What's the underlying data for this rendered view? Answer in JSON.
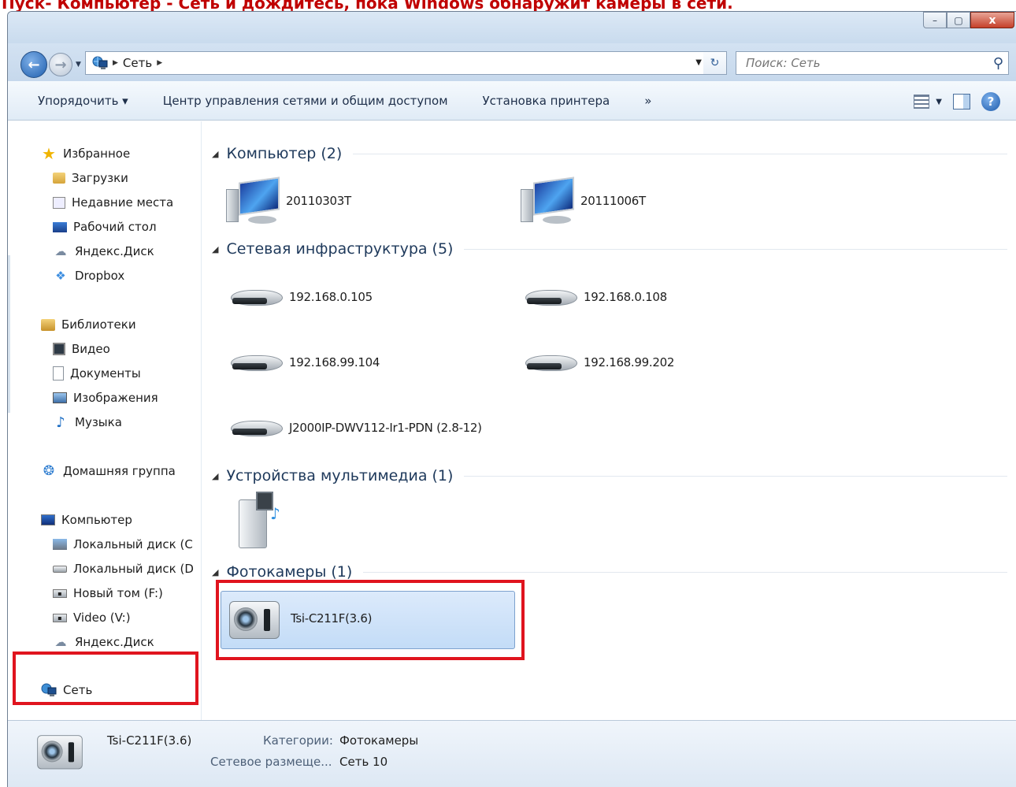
{
  "annotation": "Пуск- Компьютер - Сеть и дождитесь, пока Windows обнаружит камеры в сети.",
  "window": {
    "caption_buttons": {
      "minimize": "–",
      "maximize": "▢",
      "close": "x"
    }
  },
  "address_bar": {
    "breadcrumb": [
      "Сеть"
    ],
    "search_placeholder": "Поиск: Сеть"
  },
  "toolbar": {
    "organize": "Упорядочить ▾",
    "network_center": "Центр управления сетями и общим доступом",
    "add_printer": "Установка принтера",
    "more": "»"
  },
  "nav_pane": {
    "favorites": {
      "label": "Избранное",
      "items": [
        "Загрузки",
        "Недавние места",
        "Рабочий стол",
        "Яндекс.Диск",
        "Dropbox"
      ]
    },
    "libraries": {
      "label": "Библиотеки",
      "items": [
        "Видео",
        "Документы",
        "Изображения",
        "Музыка"
      ]
    },
    "homegroup": "Домашняя группа",
    "computer": {
      "label": "Компьютер",
      "items": [
        "Локальный диск (C",
        "Локальный диск (D",
        "Новый том (F:)",
        "Video (V:)",
        "Яндекс.Диск"
      ]
    },
    "network": "Сеть"
  },
  "groups": {
    "computer": {
      "title": "Компьютер (2)",
      "items": [
        "20110303T",
        "20111006T"
      ]
    },
    "infrastructure": {
      "title": "Сетевая инфраструктура (5)",
      "items": [
        "192.168.0.105",
        "192.168.0.108",
        "192.168.99.104",
        "192.168.99.202",
        "J2000IP-DWV112-Ir1-PDN (2.8-12)"
      ]
    },
    "multimedia": {
      "title": "Устройства мультимедиа (1)"
    },
    "cameras": {
      "title": "Фотокамеры (1)",
      "items": [
        "Tsi-C211F(3.6)"
      ]
    }
  },
  "details": {
    "name": "Tsi-C211F(3.6)",
    "category_label": "Категории:",
    "category_value": "Фотокамеры",
    "location_label": "Сетевое размеще...",
    "location_value": "Сеть 10"
  },
  "colors": {
    "annotation": "#c00000",
    "highlight_box": "#e0141e",
    "group_title": "#1e395b",
    "selection": "#c3dcf7"
  }
}
